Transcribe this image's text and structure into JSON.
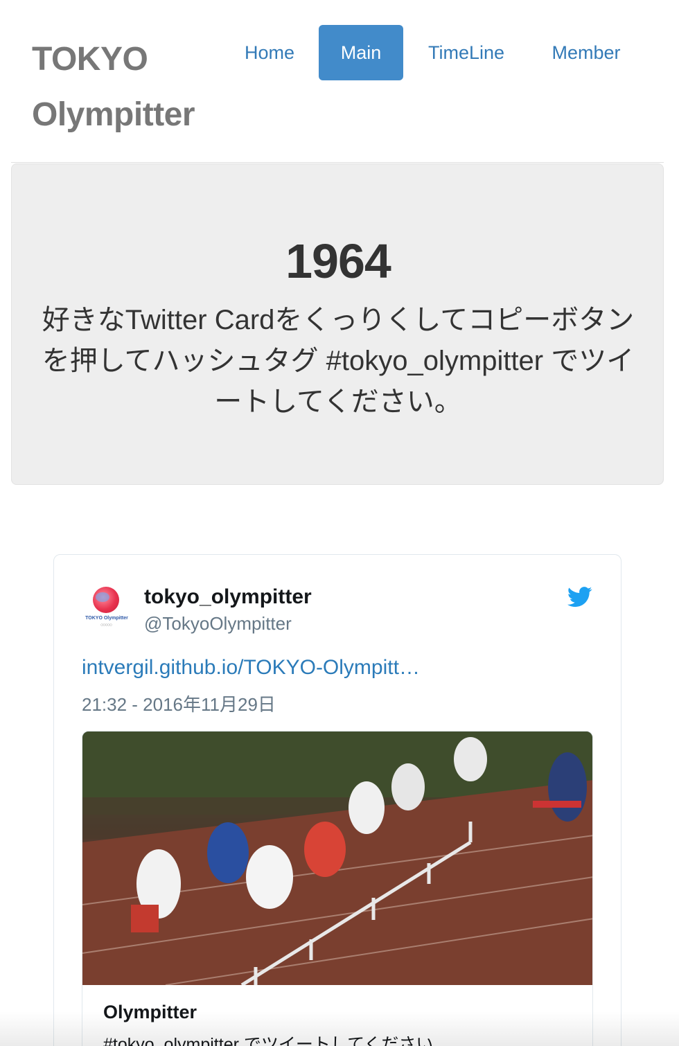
{
  "header": {
    "brand_line1": "TOKYO",
    "brand_line2": "Olympitter",
    "nav": [
      {
        "label": "Home",
        "active": false
      },
      {
        "label": "Main",
        "active": true
      },
      {
        "label": "TimeLine",
        "active": false
      },
      {
        "label": "Member",
        "active": false
      }
    ]
  },
  "jumbotron": {
    "title": "1964",
    "text": "好きなTwitter Cardをくっりくしてコピーボタンを押してハッシュタグ #tokyo_olympitter でツイートしてください。"
  },
  "tweet": {
    "display_name": "tokyo_olympitter",
    "handle": "@TokyoOlympitter",
    "avatar_text": "TOKYO Olympitter",
    "link_text": "intvergil.github.io/TOKYO-Olympitt…",
    "timestamp": "21:32 - 2016年11月29日",
    "card": {
      "title": "Olympitter",
      "description": "#tokyo_olympitter でツイートしてください"
    }
  },
  "icons": {
    "twitter": "twitter-bird-icon",
    "avatar": "olympitter-logo"
  },
  "colors": {
    "nav_link": "#337ab7",
    "nav_active_bg": "#428bca",
    "jumbotron_bg": "#eeeeee",
    "twitter_blue": "#1da1f2",
    "tweet_link": "#2b7bb9"
  }
}
